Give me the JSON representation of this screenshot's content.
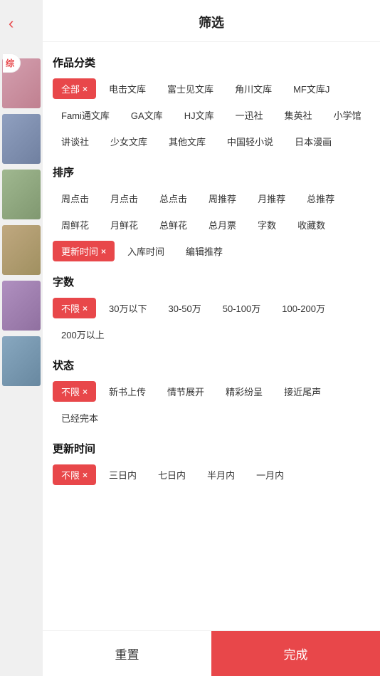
{
  "header": {
    "title": "筛选",
    "back_icon": "‹"
  },
  "sidebar": {
    "active_label": "综",
    "books": [
      {
        "color": "book-color-1"
      },
      {
        "color": "book-color-2"
      },
      {
        "color": "book-color-3"
      },
      {
        "color": "book-color-4"
      },
      {
        "color": "book-color-5"
      },
      {
        "color": "book-color-6"
      }
    ]
  },
  "sections": [
    {
      "id": "category",
      "title": "作品分类",
      "tags": [
        {
          "label": "全部",
          "active": true
        },
        {
          "label": "电击文库",
          "active": false
        },
        {
          "label": "富士见文库",
          "active": false
        },
        {
          "label": "角川文库",
          "active": false
        },
        {
          "label": "MF文库J",
          "active": false
        },
        {
          "label": "Fami通文库",
          "active": false
        },
        {
          "label": "GA文库",
          "active": false
        },
        {
          "label": "HJ文库",
          "active": false
        },
        {
          "label": "一迅社",
          "active": false
        },
        {
          "label": "集英社",
          "active": false
        },
        {
          "label": "小学馆",
          "active": false
        },
        {
          "label": "讲谈社",
          "active": false
        },
        {
          "label": "少女文库",
          "active": false
        },
        {
          "label": "其他文库",
          "active": false
        },
        {
          "label": "中国轻小说",
          "active": false
        },
        {
          "label": "日本漫画",
          "active": false
        }
      ]
    },
    {
      "id": "sort",
      "title": "排序",
      "tags": [
        {
          "label": "周点击",
          "active": false
        },
        {
          "label": "月点击",
          "active": false
        },
        {
          "label": "总点击",
          "active": false
        },
        {
          "label": "周推荐",
          "active": false
        },
        {
          "label": "月推荐",
          "active": false
        },
        {
          "label": "总推荐",
          "active": false
        },
        {
          "label": "周鲜花",
          "active": false
        },
        {
          "label": "月鲜花",
          "active": false
        },
        {
          "label": "总鲜花",
          "active": false
        },
        {
          "label": "总月票",
          "active": false
        },
        {
          "label": "字数",
          "active": false
        },
        {
          "label": "收藏数",
          "active": false
        },
        {
          "label": "更新时间",
          "active": true
        },
        {
          "label": "入库时间",
          "active": false
        },
        {
          "label": "编辑推荐",
          "active": false
        }
      ]
    },
    {
      "id": "wordcount",
      "title": "字数",
      "tags": [
        {
          "label": "不限",
          "active": true
        },
        {
          "label": "30万以下",
          "active": false
        },
        {
          "label": "30-50万",
          "active": false
        },
        {
          "label": "50-100万",
          "active": false
        },
        {
          "label": "100-200万",
          "active": false
        },
        {
          "label": "200万以上",
          "active": false
        }
      ]
    },
    {
      "id": "status",
      "title": "状态",
      "tags": [
        {
          "label": "不限",
          "active": true
        },
        {
          "label": "新书上传",
          "active": false
        },
        {
          "label": "情节展开",
          "active": false
        },
        {
          "label": "精彩纷呈",
          "active": false
        },
        {
          "label": "接近尾声",
          "active": false
        },
        {
          "label": "已经完本",
          "active": false
        }
      ]
    },
    {
      "id": "update_time",
      "title": "更新时间",
      "tags": [
        {
          "label": "不限",
          "active": true
        },
        {
          "label": "三日内",
          "active": false
        },
        {
          "label": "七日内",
          "active": false
        },
        {
          "label": "半月内",
          "active": false
        },
        {
          "label": "一月内",
          "active": false
        }
      ]
    }
  ],
  "footer": {
    "reset_label": "重置",
    "confirm_label": "完成"
  },
  "colors": {
    "accent": "#e8474a"
  }
}
